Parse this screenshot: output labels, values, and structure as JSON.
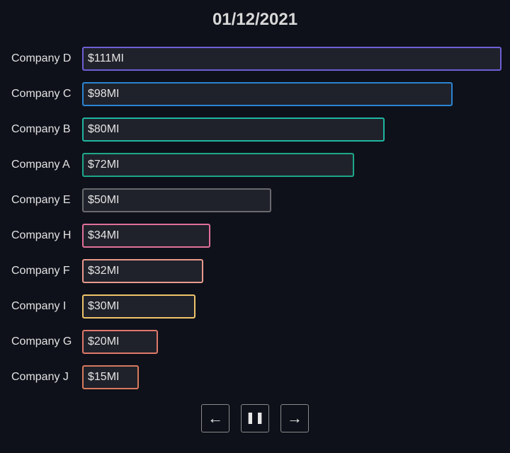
{
  "title": "01/12/2021",
  "chart_data": {
    "type": "bar",
    "orientation": "horizontal",
    "title": "01/12/2021",
    "categories": [
      "Company D",
      "Company C",
      "Company B",
      "Company A",
      "Company E",
      "Company H",
      "Company F",
      "Company I",
      "Company G",
      "Company J"
    ],
    "values": [
      111,
      98,
      80,
      72,
      50,
      34,
      32,
      30,
      20,
      15
    ],
    "value_labels": [
      "$111MI",
      "$98MI",
      "$80MI",
      "$72MI",
      "$50MI",
      "$34MI",
      "$32MI",
      "$30MI",
      "$20MI",
      "$15MI"
    ],
    "colors": [
      "#6f5fd6",
      "#2a84d2",
      "#1fb5a0",
      "#1da88a",
      "#6a6a6e",
      "#e0709a",
      "#e89a8c",
      "#efc36a",
      "#e0786a",
      "#d77a5c"
    ],
    "xlim": [
      0,
      111
    ]
  },
  "controls": {
    "prev_icon": "←",
    "pause_icon": "⏸",
    "next_icon": "→"
  }
}
